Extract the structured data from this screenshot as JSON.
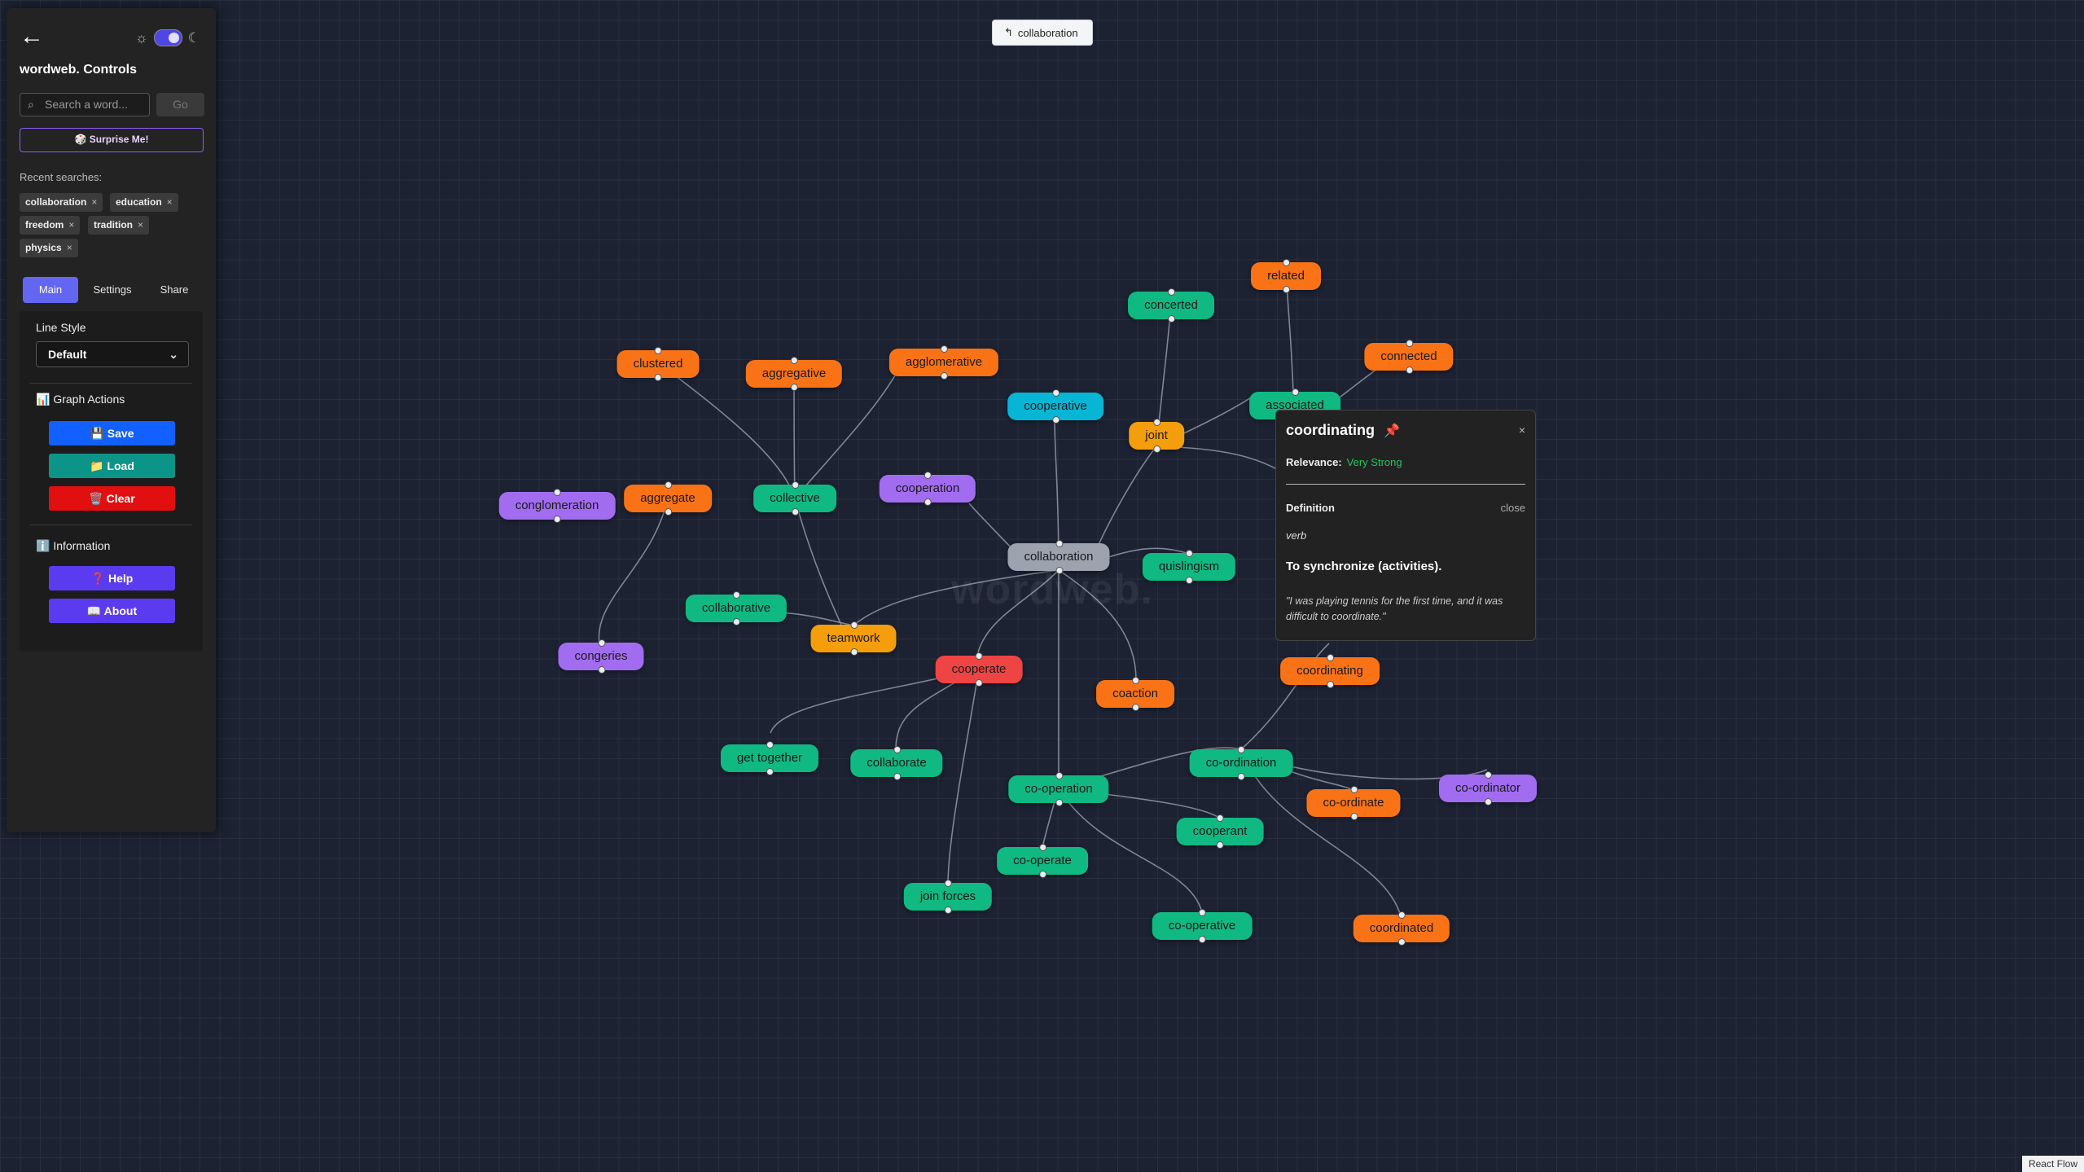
{
  "app": {
    "watermark": "wordweb."
  },
  "back_chip": {
    "icon": "undo-arrow-icon",
    "label": "collaboration"
  },
  "panel": {
    "title": "wordweb. Controls",
    "search": {
      "placeholder": "Search a word...",
      "go_label": "Go"
    },
    "surprise_label": "🎲 Surprise Me!",
    "recent_label": "Recent searches:",
    "recent": [
      "collaboration",
      "education",
      "freedom",
      "tradition",
      "physics"
    ],
    "chip_close": "×",
    "tabs": [
      "Main",
      "Settings",
      "Share"
    ],
    "active_tab": "Main",
    "line_style": {
      "label": "Line Style",
      "value": "Default"
    },
    "graph_actions": {
      "label": "📊 Graph Actions",
      "save": "💾 Save",
      "load": "📁 Load",
      "clear": "🗑️ Clear"
    },
    "information": {
      "label": "ℹ️ Information",
      "help": "❓ Help",
      "about": "📖 About"
    }
  },
  "graph": {
    "nodes": [
      {
        "label": "collaboration",
        "color": "#9ca3af"
      },
      {
        "label": "clustered",
        "color": "#f97316"
      },
      {
        "label": "aggregative",
        "color": "#f97316"
      },
      {
        "label": "agglomerative",
        "color": "#f97316"
      },
      {
        "label": "concerted",
        "color": "#10b981"
      },
      {
        "label": "related",
        "color": "#f97316"
      },
      {
        "label": "connected",
        "color": "#f97316"
      },
      {
        "label": "cooperative",
        "color": "#06b6d4"
      },
      {
        "label": "joint",
        "color": "#f59e0b"
      },
      {
        "label": "associated",
        "color": "#10b981"
      },
      {
        "label": "conglomeration",
        "color": "#a26cf0"
      },
      {
        "label": "aggregate",
        "color": "#f97316"
      },
      {
        "label": "collective",
        "color": "#10b981"
      },
      {
        "label": "cooperation",
        "color": "#a26cf0"
      },
      {
        "label": "quislingism",
        "color": "#10b981"
      },
      {
        "label": "collaborative",
        "color": "#10b981"
      },
      {
        "label": "teamwork",
        "color": "#f59e0b"
      },
      {
        "label": "congeries",
        "color": "#a26cf0"
      },
      {
        "label": "cooperate",
        "color": "#ef4444"
      },
      {
        "label": "coaction",
        "color": "#f97316"
      },
      {
        "label": "coordinating",
        "color": "#f97316"
      },
      {
        "label": "get together",
        "color": "#10b981"
      },
      {
        "label": "collaborate",
        "color": "#10b981"
      },
      {
        "label": "co-ordination",
        "color": "#10b981"
      },
      {
        "label": "co-operation",
        "color": "#10b981"
      },
      {
        "label": "co-ordinate",
        "color": "#f97316"
      },
      {
        "label": "co-ordinator",
        "color": "#a26cf0"
      },
      {
        "label": "cooperant",
        "color": "#10b981"
      },
      {
        "label": "co-operate",
        "color": "#10b981"
      },
      {
        "label": "join forces",
        "color": "#10b981"
      },
      {
        "label": "co-operative",
        "color": "#10b981"
      },
      {
        "label": "coordinated",
        "color": "#f97316"
      }
    ]
  },
  "popup": {
    "word": "coordinating",
    "pin_icon": "📌",
    "close_x": "×",
    "relevance_label": "Relevance:",
    "relevance_value": "Very Strong",
    "definition_label": "Definition",
    "close_label": "close",
    "part_of_speech": "verb",
    "definition": "To synchronize (activities).",
    "example": "\"I was playing tennis for the first time, and it was difficult to coordinate.\""
  },
  "footer": {
    "attribution": "React Flow"
  }
}
